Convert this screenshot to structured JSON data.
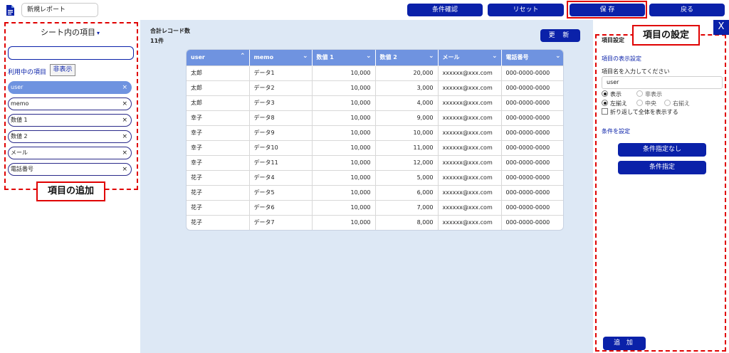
{
  "header": {
    "report_name": "新規レポート",
    "buttons": {
      "check_conditions": "条件確認",
      "reset": "リセット",
      "save": "保 存",
      "back": "戻る"
    }
  },
  "left_panel": {
    "title": "シート内の項目",
    "caret": "▾",
    "search_value": "",
    "in_use_label": "利用中の項目",
    "hide_button": "非表示",
    "fields": [
      "user",
      "memo",
      "数値 1",
      "数値 2",
      "メール",
      "電話番号"
    ],
    "remove_glyph": "×",
    "callout": "項目の追加"
  },
  "main": {
    "record_label": "合計レコード数",
    "record_count": "11件",
    "refresh_button": "更 新",
    "table": {
      "headers": [
        "user",
        "memo",
        "数値 1",
        "数値 2",
        "メール",
        "電話番号"
      ],
      "header_icons": [
        "chevron-up-icon",
        "chevron-down-icon",
        "chevron-down-icon",
        "chevron-down-icon",
        "chevron-down-icon",
        "chevron-down-icon"
      ],
      "rows": [
        [
          "太郎",
          "データ1",
          "10,000",
          "20,000",
          "xxxxxx@xxx.com",
          "000-0000-0000"
        ],
        [
          "太郎",
          "データ2",
          "10,000",
          "3,000",
          "xxxxxx@xxx.com",
          "000-0000-0000"
        ],
        [
          "太郎",
          "データ3",
          "10,000",
          "4,000",
          "xxxxxx@xxx.com",
          "000-0000-0000"
        ],
        [
          "幸子",
          "データ8",
          "10,000",
          "9,000",
          "xxxxxx@xxx.com",
          "000-0000-0000"
        ],
        [
          "幸子",
          "データ9",
          "10,000",
          "10,000",
          "xxxxxx@xxx.com",
          "000-0000-0000"
        ],
        [
          "幸子",
          "データ10",
          "10,000",
          "11,000",
          "xxxxxx@xxx.com",
          "000-0000-0000"
        ],
        [
          "幸子",
          "データ11",
          "10,000",
          "12,000",
          "xxxxxx@xxx.com",
          "000-0000-0000"
        ],
        [
          "花子",
          "データ4",
          "10,000",
          "5,000",
          "xxxxxx@xxx.com",
          "000-0000-0000"
        ],
        [
          "花子",
          "データ5",
          "10,000",
          "6,000",
          "xxxxxx@xxx.com",
          "000-0000-0000"
        ],
        [
          "花子",
          "データ6",
          "10,000",
          "7,000",
          "xxxxxx@xxx.com",
          "000-0000-0000"
        ],
        [
          "花子",
          "データ7",
          "10,000",
          "8,000",
          "xxxxxx@xxx.com",
          "000-0000-0000"
        ]
      ]
    }
  },
  "right_panel": {
    "close_glyph": "X",
    "title": "項目設定",
    "callout": "項目の設定",
    "display_section": "項目の表示設定",
    "name_label": "項目名を入力してください",
    "name_value": "user",
    "visibility": [
      {
        "label": "表示",
        "selected": true
      },
      {
        "label": "非表示",
        "selected": false
      }
    ],
    "alignment": [
      {
        "label": "左揃え",
        "selected": true
      },
      {
        "label": "中央",
        "selected": false
      },
      {
        "label": "右揃え",
        "selected": false
      }
    ],
    "wrap_label": "折り返して全体を表示する",
    "wrap_checked": false,
    "condition_section": "条件を設定",
    "no_condition_button": "条件指定なし",
    "condition_button": "条件指定",
    "add_button": "追 加"
  },
  "colors": {
    "primary": "#0a21a9",
    "accent": "#6f93e0",
    "highlight": "#e00000",
    "main_bg": "#dde8f5"
  }
}
